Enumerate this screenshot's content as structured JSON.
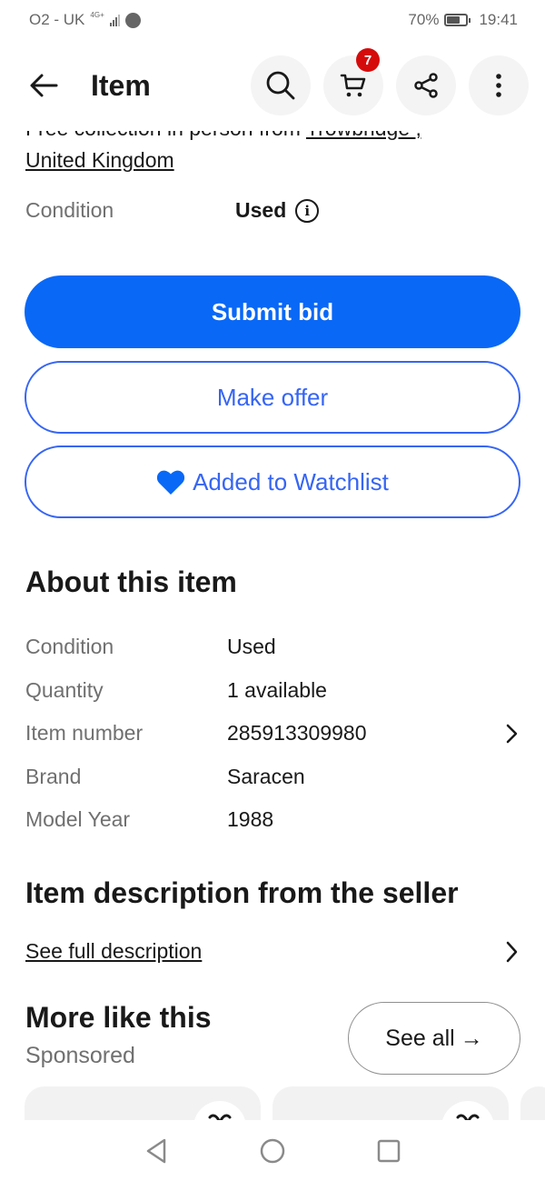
{
  "status_bar": {
    "carrier": "O2 - UK",
    "network": "4G+",
    "battery": "70%",
    "battery_level": 0.7,
    "time": "19:41"
  },
  "header": {
    "title": "Item",
    "cart_count": "7",
    "icons": [
      "back-arrow-icon",
      "search-icon",
      "cart-icon",
      "share-icon",
      "more-vert-icon"
    ]
  },
  "shipping": {
    "clipped_line_prefix": "Free collection in person from ",
    "clipped_line_link": "Trowbridge ,",
    "location_link": "United Kingdom "
  },
  "condition": {
    "label": "Condition",
    "value": "Used"
  },
  "actions": {
    "submit_bid": "Submit bid",
    "make_offer": "Make offer",
    "watchlist": "Added to Watchlist"
  },
  "about": {
    "title": "About this item",
    "specs": [
      {
        "label": "Condition",
        "value": "Used"
      },
      {
        "label": "Quantity",
        "value": "1 available"
      },
      {
        "label": "Item number",
        "value": "285913309980"
      },
      {
        "label": "Brand",
        "value": "Saracen"
      },
      {
        "label": "Model Year",
        "value": "1988"
      }
    ]
  },
  "description": {
    "title": "Item description from the seller",
    "link": "See full description"
  },
  "more_like_this": {
    "title": "More like this",
    "subtitle": "Sponsored",
    "see_all": "See all",
    "see_all_arrow": "→"
  },
  "colors": {
    "primary": "#0968f6",
    "link_blue": "#3665f3",
    "badge_red": "#d50b0b",
    "text": "#191919",
    "muted": "#707070"
  }
}
